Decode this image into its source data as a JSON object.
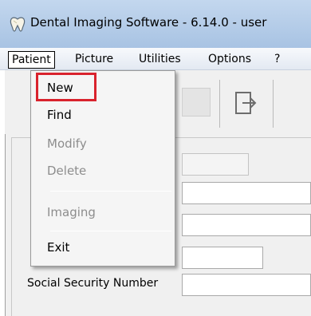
{
  "window": {
    "title": "Dental Imaging Software - 6.14.0 - user",
    "icon": "tooth-icon"
  },
  "menubar": {
    "items": [
      "Patient",
      "Picture",
      "Utilities",
      "Options",
      "?"
    ],
    "active": "Patient"
  },
  "patient_menu": {
    "items": [
      {
        "label": "New",
        "enabled": true,
        "highlighted": true
      },
      {
        "label": "Find",
        "enabled": true
      },
      {
        "label": "Modify",
        "enabled": false
      },
      {
        "label": "Delete",
        "enabled": false
      },
      {
        "label": "Imaging",
        "enabled": false
      },
      {
        "label": "Exit",
        "enabled": true
      }
    ]
  },
  "toolbar": {
    "exit_icon": "exit-icon"
  },
  "form": {
    "ssn_label": "Social Security Number"
  },
  "colors": {
    "highlight": "#d9232d",
    "titlebar": "#b7cde9",
    "disabled_text": "#8d8d8d"
  }
}
